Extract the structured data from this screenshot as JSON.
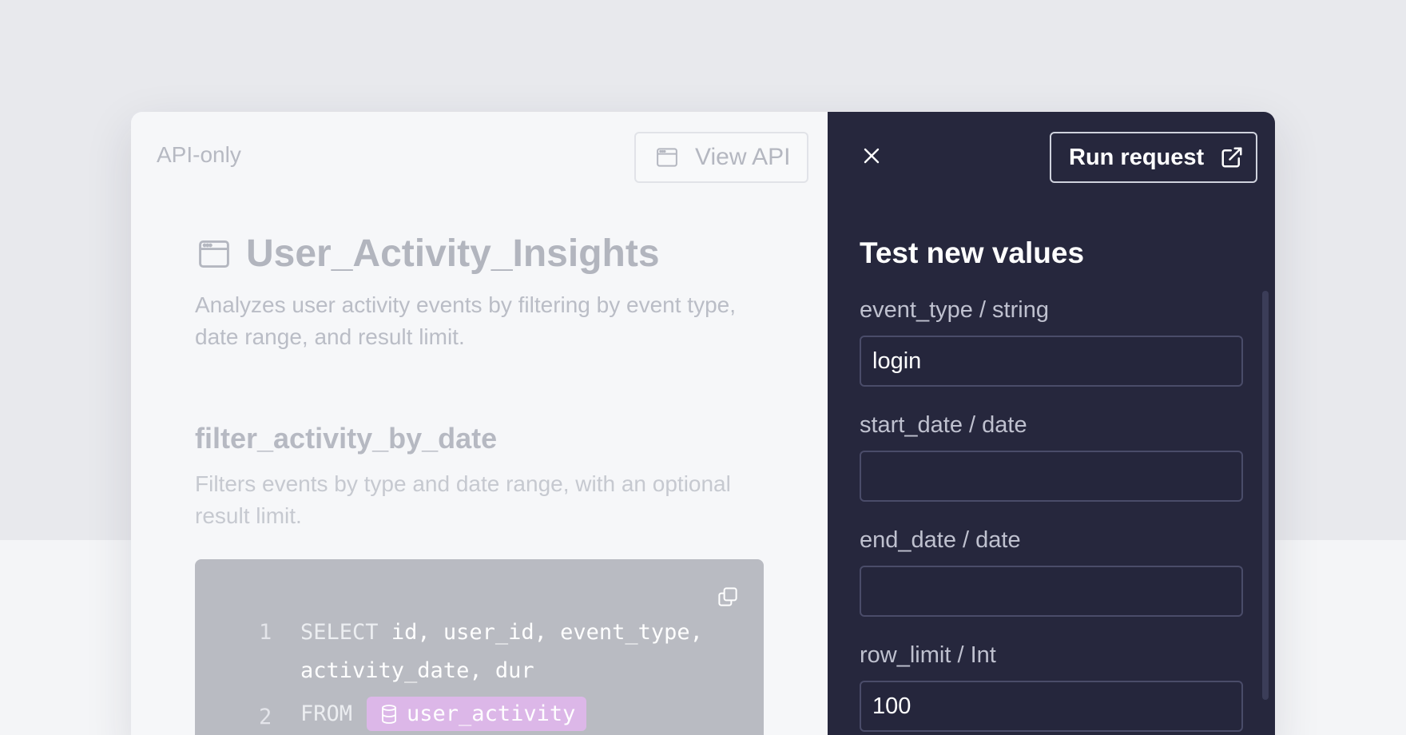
{
  "left_panel": {
    "badge": "API-only",
    "view_api_label": "View API",
    "title": "User_Activity_Insights",
    "description": "Analyzes user activity events by filtering by event type, date range, and result limit.",
    "section": {
      "title": "filter_activity_by_date",
      "description": "Filters events by type and date range, with an optional result limit."
    },
    "code": {
      "lines": [
        {
          "number": "1",
          "keyword": "SELECT",
          "text": "id, user_id, event_type, activity_date, dur"
        },
        {
          "number": "2",
          "keyword": "FROM",
          "table": "user_activity"
        }
      ]
    }
  },
  "right_panel": {
    "run_label": "Run request",
    "title": "Test new values",
    "fields": [
      {
        "label": "event_type / string",
        "value": "login"
      },
      {
        "label": "start_date / date",
        "value": ""
      },
      {
        "label": "end_date / date",
        "value": ""
      },
      {
        "label": "row_limit / Int",
        "value": "100"
      }
    ]
  },
  "icons": {
    "view_api": "browser-window-icon",
    "title": "browser-window-icon",
    "copy": "copy-icon",
    "table": "database-icon",
    "close": "close-icon",
    "run": "external-link-icon"
  },
  "colors": {
    "dark_panel": "#26273d",
    "table_chip": "#dcb7e8",
    "input_border": "#4a4c69"
  }
}
